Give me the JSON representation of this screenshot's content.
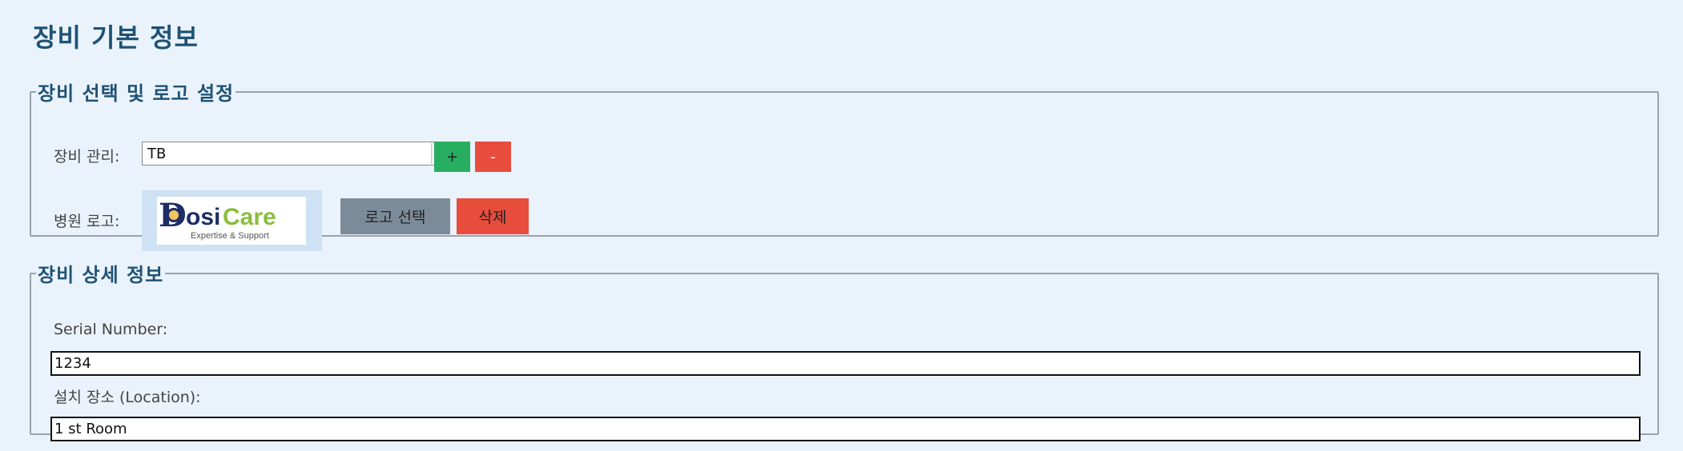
{
  "page": {
    "title": "장비 기본 정보"
  },
  "equipment_logo_group": {
    "legend": "장비 선택 및 로고 설정",
    "equipment_label": "장비 관리:",
    "equipment_selected": "TB",
    "add_label": "+",
    "remove_label": "-",
    "logo_label": "병원 로고:",
    "logo": {
      "brand_d": "D",
      "brand_osi": "osi",
      "brand_care": "Care",
      "tagline": "Expertise & Support"
    },
    "select_logo_label": "로고 선택",
    "delete_logo_label": "삭제"
  },
  "equipment_detail_group": {
    "legend": "장비 상세 정보",
    "serial_label": "Serial Number:",
    "serial_value": "1234",
    "location_label": "설치 장소 (Location):",
    "location_value": "1 st Room"
  },
  "colors": {
    "background": "#eaf3fb",
    "heading": "#1f5275",
    "add_button": "#27ae60",
    "danger_button": "#e74c3c",
    "neutral_button": "#7c8b99"
  }
}
